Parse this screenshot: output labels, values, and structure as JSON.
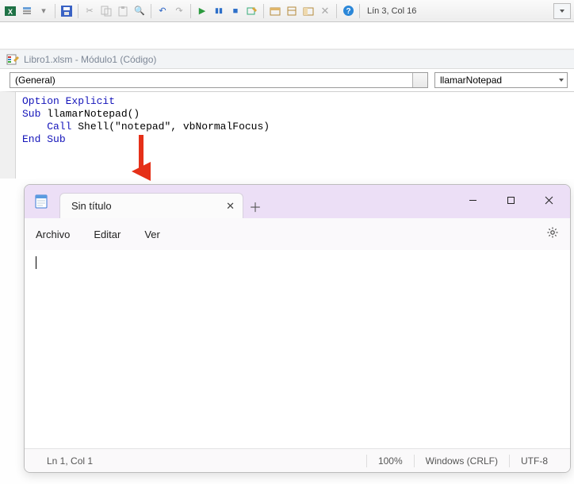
{
  "toolbar": {
    "position_text": "Lín 3, Col 16"
  },
  "code_window": {
    "title": "Libro1.xlsm - Módulo1 (Código)",
    "object_dropdown": "(General)",
    "procedure_dropdown": "llamarNotepad",
    "code": {
      "line1_kw1": "Option",
      "line1_kw2": "Explicit",
      "line2_kw": "Sub",
      "line2_name": "llamarNotepad()",
      "line3_kw": "Call",
      "line3_rest": "Shell(\"notepad\", vbNormalFocus)",
      "line4_kw1": "End",
      "line4_kw2": "Sub"
    }
  },
  "notepad": {
    "tab_title": "Sin título",
    "menu": {
      "file": "Archivo",
      "edit": "Editar",
      "view": "Ver"
    },
    "status": {
      "pos": "Ln 1, Col 1",
      "zoom": "100%",
      "eol": "Windows (CRLF)",
      "encoding": "UTF-8"
    }
  }
}
